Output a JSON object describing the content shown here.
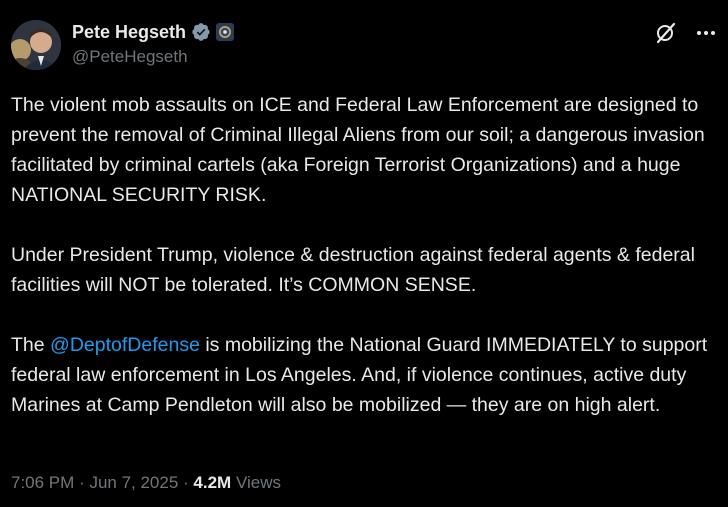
{
  "author": {
    "name": "Pete Hegseth",
    "handle": "@PeteHegseth"
  },
  "tweet": {
    "para1": "The violent mob assaults on ICE and Federal Law Enforcement are designed to prevent the removal of Criminal Illegal Aliens from our soil; a dangerous invasion facilitated by criminal cartels (aka Foreign Terrorist Organizations) and a huge NATIONAL SECURITY RISK.",
    "para2": "Under President Trump, violence & destruction against federal agents & federal facilities will NOT be tolerated. It’s COMMON SENSE.",
    "para3_pre": "The ",
    "para3_mention": "@DeptofDefense",
    "para3_post": " is mobilizing the National Guard IMMEDIATELY to support federal law enforcement in Los Angeles. And, if violence continues, active duty Marines at Camp Pendleton will also be mobilized — they are on high alert."
  },
  "meta": {
    "time": "7:06 PM",
    "date": "Jun 7, 2025",
    "views_count": "4.2M",
    "views_label": "Views",
    "separator": "·"
  },
  "colors": {
    "background": "#000000",
    "text": "#e7e9ea",
    "secondary": "#71767b",
    "link": "#1d9bf0"
  },
  "icons": {
    "verified": "verified-badge-icon",
    "affiliation": "dod-seal-icon",
    "grok": "grok-icon",
    "more": "more-dots-icon"
  }
}
